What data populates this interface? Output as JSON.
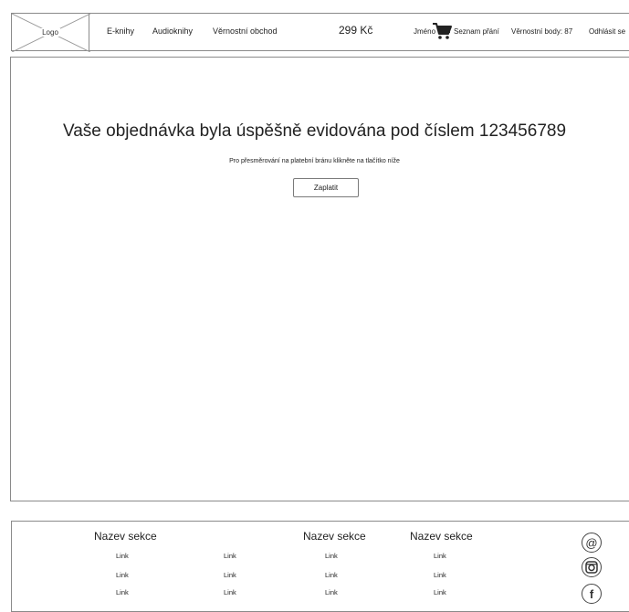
{
  "header": {
    "logo": "Logo",
    "nav": [
      "E-knihy",
      "Audioknihy",
      "Věrnostní obchod"
    ],
    "cart_total": "299 Kč",
    "user_name": "Jméno P.",
    "wishlist": "Seznam přání",
    "loyalty_points": "Věrnostní body: 87",
    "logout": "Odhlásit se"
  },
  "main": {
    "headline": "Vaše objednávka byla úspěšně evidována pod číslem 123456789",
    "subtext": "Pro přesměrování na platební bránu klikněte na tlačítko níže",
    "pay_button": "Zaplatit"
  },
  "footer": {
    "section_titles": [
      "Nazev sekce",
      "Nazev sekce",
      "Nazev sekce"
    ],
    "columns": [
      [
        "Link",
        "Link",
        "Link"
      ],
      [
        "Link",
        "Link",
        "Link"
      ],
      [
        "Link",
        "Link",
        "Link"
      ],
      [
        "Link",
        "Link",
        "Link"
      ]
    ],
    "social_icons": [
      "email-icon",
      "instagram-icon",
      "facebook-icon"
    ],
    "social_glyphs": {
      "email": "@",
      "facebook": "f"
    }
  }
}
